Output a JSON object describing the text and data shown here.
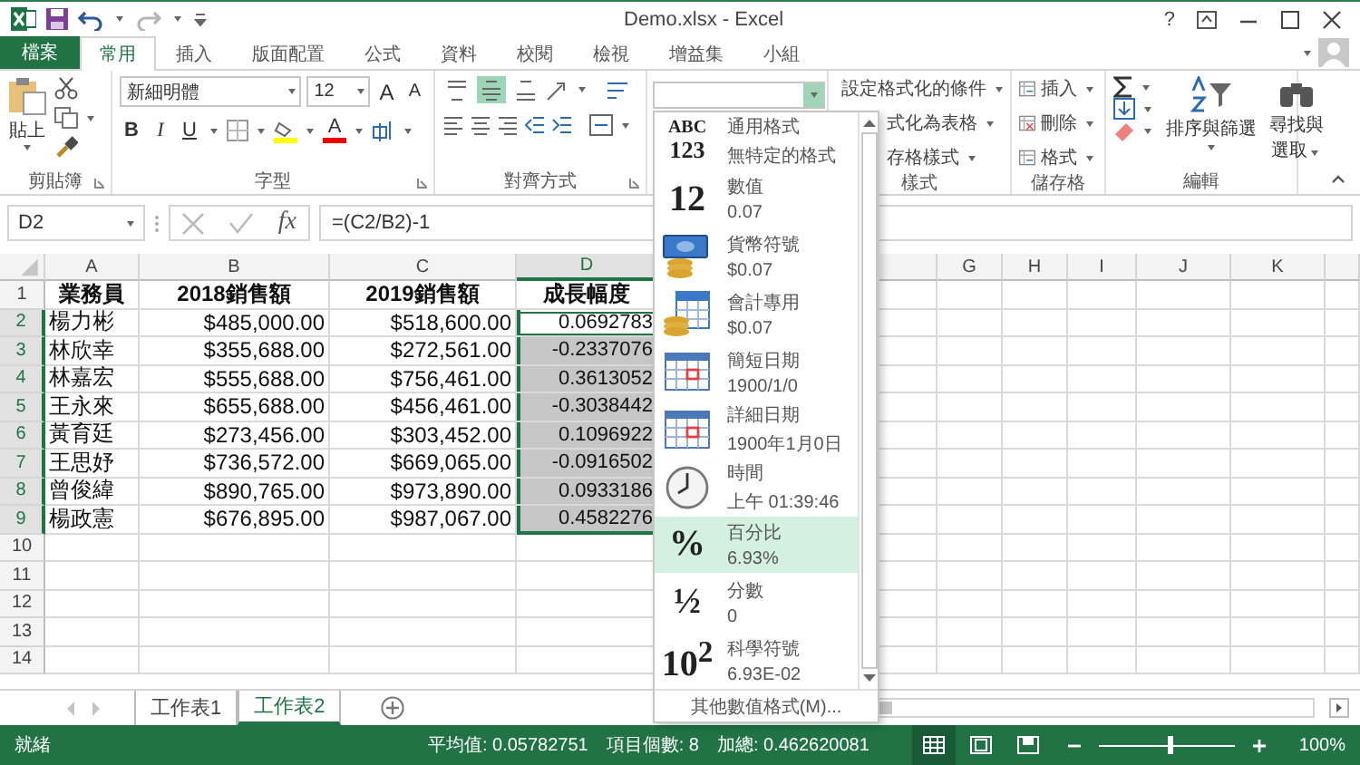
{
  "title_bar": {
    "title": "Demo.xlsx - Excel",
    "help": "?"
  },
  "ribbon_tabs": [
    {
      "label": "檔案",
      "kind": "file",
      "selected": false
    },
    {
      "label": "常用",
      "kind": "tab",
      "selected": true
    },
    {
      "label": "插入",
      "kind": "tab",
      "selected": false
    },
    {
      "label": "版面配置",
      "kind": "tab",
      "selected": false
    },
    {
      "label": "公式",
      "kind": "tab",
      "selected": false
    },
    {
      "label": "資料",
      "kind": "tab",
      "selected": false
    },
    {
      "label": "校閱",
      "kind": "tab",
      "selected": false
    },
    {
      "label": "檢視",
      "kind": "tab",
      "selected": false
    },
    {
      "label": "增益集",
      "kind": "tab",
      "selected": false
    },
    {
      "label": "小組",
      "kind": "tab",
      "selected": false
    }
  ],
  "ribbon": {
    "clipboard": {
      "label": "剪貼簿",
      "paste": "貼上"
    },
    "font": {
      "label": "字型",
      "font_name": "新細明體",
      "font_size": "12",
      "grow": "A",
      "shrink": "A",
      "bold": "B",
      "italic": "I",
      "underline": "U",
      "font_color": "A"
    },
    "alignment": {
      "label": "對齊方式",
      "vertical": [
        {
          "selected": false
        },
        {
          "selected": true
        },
        {
          "selected": false
        }
      ]
    },
    "styles": {
      "label": "樣式",
      "items": [
        "設定格式化的條件",
        "式化為表格",
        "存格樣式"
      ]
    },
    "cells": {
      "label": "儲存格",
      "items": [
        "插入",
        "刪除",
        "格式"
      ]
    },
    "editing": {
      "label": "編輯",
      "sort": "排序與篩選",
      "find": "尋找與選取"
    }
  },
  "formula_bar": {
    "name_box": "D2",
    "fx": "fx",
    "formula": "=(C2/B2)-1"
  },
  "sheet": {
    "columns": [
      {
        "kind": "letter",
        "label": "A",
        "selected": false
      },
      {
        "kind": "letter",
        "label": "B",
        "selected": false
      },
      {
        "kind": "letter",
        "label": "C",
        "selected": false
      },
      {
        "kind": "letter",
        "label": "D",
        "selected": true
      },
      {
        "kind": "hidden"
      },
      {
        "kind": "blank",
        "selected": false
      },
      {
        "kind": "letter",
        "label": "G",
        "selected": false
      },
      {
        "kind": "letter",
        "label": "H",
        "selected": false
      },
      {
        "kind": "letter",
        "label": "I",
        "selected": false
      },
      {
        "kind": "letter",
        "label": "J",
        "selected": false
      },
      {
        "kind": "letter",
        "label": "K",
        "selected": false
      }
    ],
    "rows": [
      {
        "num": "1",
        "kind": "header",
        "selected": false,
        "active": false,
        "cells": [
          "業務員",
          "2018銷售額",
          "2019銷售額",
          "成長幅度"
        ]
      },
      {
        "num": "2",
        "kind": "data",
        "selected": true,
        "active": true,
        "cells": [
          "楊力彬",
          "$485,000.00",
          "$518,600.00",
          "0.0692783"
        ]
      },
      {
        "num": "3",
        "kind": "data",
        "selected": true,
        "active": false,
        "cells": [
          "林欣幸",
          "$355,688.00",
          "$272,561.00",
          "-0.2337076"
        ]
      },
      {
        "num": "4",
        "kind": "data",
        "selected": true,
        "active": false,
        "cells": [
          "林嘉宏",
          "$555,688.00",
          "$756,461.00",
          "0.3613052"
        ]
      },
      {
        "num": "5",
        "kind": "data",
        "selected": true,
        "active": false,
        "cells": [
          "王永來",
          "$655,688.00",
          "$456,461.00",
          "-0.3038442"
        ]
      },
      {
        "num": "6",
        "kind": "data",
        "selected": true,
        "active": false,
        "cells": [
          "黃育廷",
          "$273,456.00",
          "$303,452.00",
          "0.1096922"
        ]
      },
      {
        "num": "7",
        "kind": "data",
        "selected": true,
        "active": false,
        "cells": [
          "王思妤",
          "$736,572.00",
          "$669,065.00",
          "-0.0916502"
        ]
      },
      {
        "num": "8",
        "kind": "data",
        "selected": true,
        "active": false,
        "cells": [
          "曾俊緯",
          "$890,765.00",
          "$973,890.00",
          "0.0933186"
        ]
      },
      {
        "num": "9",
        "kind": "data",
        "selected": true,
        "active": false,
        "cells": [
          "楊政憲",
          "$676,895.00",
          "$987,067.00",
          "0.4582276"
        ]
      },
      {
        "num": "10",
        "kind": "data",
        "selected": false,
        "active": false
      },
      {
        "num": "11",
        "kind": "data",
        "selected": false,
        "active": false
      },
      {
        "num": "12",
        "kind": "data",
        "selected": false,
        "active": false
      },
      {
        "num": "13",
        "kind": "data",
        "selected": false,
        "active": false
      },
      {
        "num": "14",
        "kind": "data",
        "selected": false,
        "active": false
      }
    ]
  },
  "number_format_menu": {
    "items": [
      {
        "kind": "stacked",
        "glyph_lines": [
          "ABC",
          "123"
        ],
        "title": "通用格式",
        "sample": "無特定的格式",
        "selected": false
      },
      {
        "kind": "glyph",
        "glyph": "12",
        "title": "數值",
        "sample": "0.07",
        "selected": false
      },
      {
        "kind": "currency",
        "title": "貨幣符號",
        "sample": "$0.07",
        "selected": false
      },
      {
        "kind": "accounting",
        "title": "會計專用",
        "sample": "$0.07",
        "selected": false
      },
      {
        "kind": "calendar",
        "title": "簡短日期",
        "sample": "1900/1/0",
        "selected": false
      },
      {
        "kind": "calendar",
        "title": "詳細日期",
        "sample": "1900年1月0日",
        "selected": false
      },
      {
        "kind": "clock",
        "title": "時間",
        "sample": "上午 01:39:46",
        "selected": false
      },
      {
        "kind": "glyph",
        "glyph": "%",
        "title": "百分比",
        "sample": "6.93%",
        "selected": true
      },
      {
        "kind": "glyph",
        "glyph": "½",
        "title": "分數",
        "sample": "0",
        "selected": false
      },
      {
        "kind": "glyph",
        "glyph": "10$^{2}$",
        "title": "科學符號",
        "sample": "6.93E-02",
        "selected": false
      }
    ],
    "footer": "其他數值格式(M)..."
  },
  "sheet_tabs": [
    {
      "label": "工作表1",
      "selected": false
    },
    {
      "label": "工作表2",
      "selected": true
    }
  ],
  "status_bar": {
    "status": "就緒",
    "average": "平均值: 0.05782751",
    "count": "項目個數: 8",
    "sum": "加總: 0.462620081",
    "views": [
      {
        "kind": "normal",
        "selected": true
      },
      {
        "kind": "page_layout",
        "selected": false
      },
      {
        "kind": "page_break",
        "selected": false
      }
    ],
    "zoom": {
      "level": 0.52,
      "reading": "100%"
    }
  }
}
